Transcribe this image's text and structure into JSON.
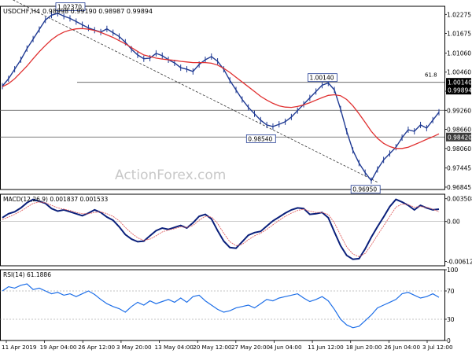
{
  "chart_data": [
    {
      "type": "line",
      "title": "USDCHF,H4",
      "ohlc": "0.98998 0.99190 0.98987 0.99894",
      "watermark": "ActionForex.com",
      "y_ticks": [
        1.02275,
        1.01675,
        1.0106,
        1.0046,
        0.9986,
        0.9926,
        0.9866,
        0.9806,
        0.97445,
        0.96845
      ],
      "ylim": [
        0.9677,
        1.0253
      ],
      "x_labels": [
        "11 Apr 2019",
        "19 Apr 04:00",
        "26 Apr 12:00",
        "3 May 20:00",
        "13 May 04:00",
        "20 May 12:00",
        "27 May 20:00",
        "4 Jun 04:00",
        "11 Jun 12:00",
        "18 Jun 20:00",
        "26 Jun 04:00",
        "3 Jul 12:00"
      ],
      "series": [
        {
          "name": "",
          "values": [
            1.0002,
            1.0025,
            1.0055,
            1.0085,
            1.012,
            1.015,
            1.018,
            1.021,
            1.0225,
            1.0231,
            1.0222,
            1.0215,
            1.0205,
            1.0195,
            1.0185,
            1.0178,
            1.0172,
            1.0182,
            1.017,
            1.0158,
            1.014,
            1.0118,
            1.01,
            1.0088,
            1.009,
            1.0105,
            1.0098,
            1.0085,
            1.0075,
            1.006,
            1.0055,
            1.0048,
            1.007,
            1.0085,
            1.0095,
            1.008,
            1.0055,
            1.002,
            0.999,
            0.996,
            0.9935,
            0.9915,
            0.9895,
            0.988,
            0.9875,
            0.9882,
            0.989,
            0.9905,
            0.9925,
            0.9945,
            0.9965,
            0.9985,
            1.0005,
            1.0012,
            0.999,
            0.993,
            0.986,
            0.98,
            0.976,
            0.973,
            0.9705,
            0.974,
            0.977,
            0.979,
            0.981,
            0.984,
            0.9865,
            0.986,
            0.988,
            0.987,
            0.9895,
            0.992
          ]
        },
        {
          "name": "",
          "values": [
            1.0,
            1.001,
            1.0025,
            1.0045,
            1.0065,
            1.0088,
            1.011,
            1.013,
            1.0148,
            1.0162,
            1.0172,
            1.0178,
            1.0182,
            1.0183,
            1.0181,
            1.0177,
            1.0171,
            1.0163,
            1.0155,
            1.0145,
            1.0135,
            1.0123,
            1.0111,
            1.01,
            1.0095,
            1.009,
            1.0087,
            1.0085,
            1.0083,
            1.008,
            1.0078,
            1.0076,
            1.0076,
            1.0076,
            1.0074,
            1.0068,
            1.0058,
            1.0045,
            1.003,
            1.0015,
            1.0,
            0.9985,
            0.997,
            0.9958,
            0.9948,
            0.994,
            0.9936,
            0.9935,
            0.9938,
            0.9943,
            0.995,
            0.9958,
            0.9966,
            0.9973,
            0.9975,
            0.9972,
            0.996,
            0.994,
            0.9915,
            0.9888,
            0.986,
            0.9838,
            0.9822,
            0.9812,
            0.9806,
            0.9806,
            0.981,
            0.9818,
            0.9826,
            0.9835,
            0.9843,
            0.9852
          ]
        }
      ],
      "horizontal_lines": [
        1.0014,
        0.9926,
        0.9842
      ],
      "trendline": {
        "from": [
          0,
          1.029
        ],
        "to": [
          61,
          0.97
        ]
      },
      "fib_label": "61.8",
      "annotations": [
        {
          "text": "1.02370",
          "x_index": 11,
          "y": 1.0237
        },
        {
          "text": "1.00140",
          "x_index": 52,
          "y": 1.0014
        },
        {
          "text": "0.98540",
          "x_index": 42,
          "y": 0.9854
        },
        {
          "text": "0.96950",
          "x_index": 59,
          "y": 0.9695
        }
      ],
      "price_tags": [
        {
          "text": "1.00140",
          "y": 1.0014,
          "bg": "#000000",
          "color": "#ffffff"
        },
        {
          "text": "0.99894",
          "y": 0.99894,
          "bg": "#000000",
          "color": "#ffffff"
        },
        {
          "text": "0.98420",
          "y": 0.9842,
          "bg": "#3c3c3c",
          "color": "#ffffff"
        }
      ]
    },
    {
      "type": "line",
      "title": "MACD(12,26,9) 0.001837 0.001533",
      "y_ticks": [
        0.003508,
        0.0,
        -0.006121
      ],
      "ylim": [
        -0.0068,
        0.0042
      ],
      "series": [
        {
          "name": "",
          "values": [
            0.0006,
            0.0012,
            0.0015,
            0.0021,
            0.0029,
            0.0034,
            0.0031,
            0.0028,
            0.002,
            0.0016,
            0.0018,
            0.0015,
            0.0012,
            0.0009,
            0.0013,
            0.0018,
            0.0014,
            0.0007,
            0.0002,
            -0.0008,
            -0.002,
            -0.0027,
            -0.0031,
            -0.003,
            -0.0022,
            -0.0014,
            -0.001,
            -0.0012,
            -0.0009,
            -0.0006,
            -0.001,
            -0.0002,
            0.0008,
            0.0011,
            0.0004,
            -0.0014,
            -0.003,
            -0.004,
            -0.0041,
            -0.0031,
            -0.0021,
            -0.0017,
            -0.0015,
            -0.0007,
            0.0001,
            0.0007,
            0.0013,
            0.0018,
            0.0021,
            0.002,
            0.0011,
            0.0012,
            0.0014,
            0.0006,
            -0.0016,
            -0.0037,
            -0.0052,
            -0.0058,
            -0.0057,
            -0.0042,
            -0.0024,
            -0.0008,
            0.0007,
            0.0023,
            0.0034,
            0.003,
            0.0025,
            0.0018,
            0.0025,
            0.0021,
            0.0018,
            0.0019
          ]
        },
        {
          "name": "",
          "values": [
            0.0003,
            0.0007,
            0.0011,
            0.0016,
            0.0022,
            0.0028,
            0.003,
            0.0029,
            0.0025,
            0.0021,
            0.0019,
            0.0017,
            0.0014,
            0.0012,
            0.0012,
            0.0014,
            0.0015,
            0.0012,
            0.0008,
            0.0001,
            -0.0009,
            -0.0018,
            -0.0025,
            -0.0029,
            -0.0027,
            -0.0022,
            -0.0016,
            -0.0013,
            -0.0011,
            -0.0008,
            -0.0009,
            -0.0006,
            0.0002,
            0.0008,
            0.0007,
            -0.0003,
            -0.0018,
            -0.0031,
            -0.0037,
            -0.0035,
            -0.0028,
            -0.0022,
            -0.0018,
            -0.0012,
            -0.0005,
            0.0002,
            0.0008,
            0.0013,
            0.0017,
            0.0019,
            0.0016,
            0.0014,
            0.0014,
            0.0011,
            -0.0002,
            -0.0021,
            -0.0039,
            -0.005,
            -0.0054,
            -0.0049,
            -0.0036,
            -0.0021,
            -0.0007,
            0.0008,
            0.0022,
            0.0027,
            0.0026,
            0.0022,
            0.0023,
            0.0022,
            0.0019,
            0.0015
          ]
        }
      ]
    },
    {
      "type": "line",
      "title": "RSI(14) 61.1886",
      "y_ticks": [
        100,
        70,
        30,
        0
      ],
      "ylim": [
        0,
        100
      ],
      "series": [
        {
          "name": "",
          "values": [
            70,
            76,
            74,
            78,
            80,
            72,
            74,
            70,
            66,
            68,
            64,
            66,
            62,
            66,
            70,
            65,
            58,
            52,
            48,
            45,
            40,
            48,
            54,
            50,
            56,
            52,
            55,
            58,
            54,
            60,
            54,
            62,
            64,
            56,
            50,
            44,
            40,
            42,
            46,
            48,
            50,
            46,
            52,
            58,
            56,
            60,
            62,
            64,
            66,
            60,
            55,
            58,
            62,
            56,
            44,
            30,
            22,
            18,
            20,
            28,
            36,
            46,
            50,
            54,
            58,
            66,
            68,
            64,
            60,
            62,
            66,
            61
          ]
        }
      ]
    }
  ]
}
